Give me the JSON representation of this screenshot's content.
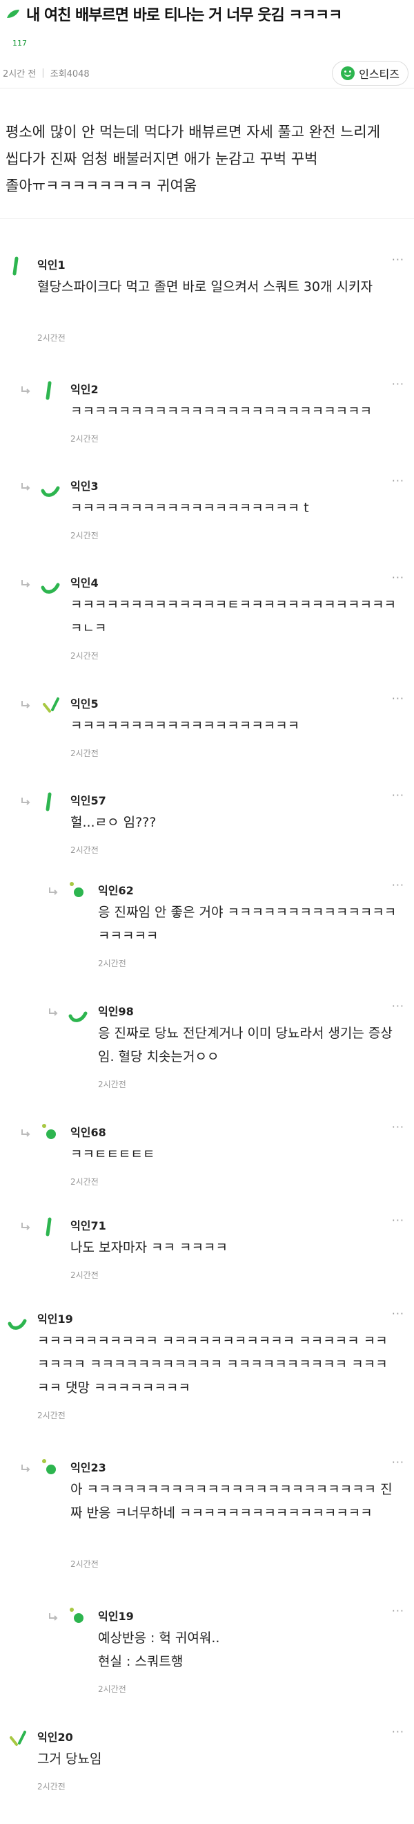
{
  "post": {
    "title": "내 여친 배부르면 바로 티나는 거 너무 웃김 ㅋㅋㅋㅋ",
    "comments_count": "117",
    "time": "2시간 전",
    "views": "조회4048",
    "insti_label": "인스티즈",
    "body": "평소에 많이 안 먹는데 먹다가 배뷰르면 자세 풀고 완전 느리게 씹다가 진짜 엄청 배불러지면 애가 눈감고 꾸벅 꾸벅 졸아ㅠㅋㅋㅋㅋㅋㅋㅋㅋ 귀여움"
  },
  "colors": {
    "accent": "#2db54f",
    "meta": "#888888"
  },
  "comments": [
    {
      "author": "익인1",
      "text": "혈당스파이크다 먹고 졸면 바로 일으켜서 스쿼트 30개 시키자",
      "time": "2시간전",
      "more": "···",
      "reply": false,
      "icon": "green-stroke-icon"
    },
    {
      "author": "익인2",
      "text": "ㅋㅋㅋㅋㅋㅋㅋㅋㅋㅋㅋㅋㅋㅋㅋㅋㅋㅋㅋㅋㅋㅋㅋㅋㅋ",
      "time": "2시간전",
      "more": "···",
      "reply": true,
      "icon": "green-stroke-icon"
    },
    {
      "author": "익인3",
      "text": "ㅋㅋㅋㅋㅋㅋㅋㅋㅋㅋㅋㅋㅋㅋㅋㅋㅋㅋㅋ t",
      "time": "2시간전",
      "more": "···",
      "reply": true,
      "icon": "green-curve-icon"
    },
    {
      "author": "익인4",
      "text": "ㅋㅋㅋㅋㅋㅋㅋㅋㅋㅋㅋㅋㅋㅌㅋㅋㅋㅋㅋㅋㅋㅋㅋㅋㅋㅋㅋㅋㄴㅋ",
      "time": "2시간전",
      "more": "···",
      "reply": true,
      "icon": "green-curve-icon"
    },
    {
      "author": "익인5",
      "text": "ㅋㅋㅋㅋㅋㅋㅋㅋㅋㅋㅋㅋㅋㅋㅋㅋㅋㅋㅋ",
      "time": "2시간전",
      "more": "···",
      "reply": true,
      "icon": "check-leaf-icon"
    },
    {
      "author": "익인57",
      "text": "헐...ㄹㅇ 임???",
      "time": "2시간전",
      "more": "···",
      "reply": true,
      "icon": "green-stroke-icon"
    },
    {
      "author": "익인62",
      "text": "응 진짜임 안 좋은 거야 ㅋㅋㅋㅋㅋㅋㅋㅋㅋㅋㅋㅋㅋㅋㅋㅋㅋㅋㅋ",
      "time": "2시간전",
      "more": "···",
      "reply": true,
      "icon": "green-dots-icon"
    },
    {
      "author": "익인98",
      "text": "응 진짜로 당뇨 전단계거나 이미 당뇨라서 생기는 증상임. 혈당 치솟는거ㅇㅇ",
      "time": "2시간전",
      "more": "···",
      "reply": true,
      "icon": "green-curve-icon"
    },
    {
      "author": "익인68",
      "text": "ㅋㅋㅌㅌㅌㅌㅌ",
      "time": "2시간전",
      "more": "···",
      "reply": true,
      "icon": "green-dots-icon"
    },
    {
      "author": "익인71",
      "text": "나도 보자마자 ㅋㅋ ㅋㅋㅋㅋ",
      "time": "2시간전",
      "more": "···",
      "reply": true,
      "icon": "green-stroke-icon"
    },
    {
      "author": "익인19",
      "text": "ㅋㅋㅋㅋㅋㅋㅋㅋㅋㅋ ㅋㅋㅋㅋㅋㅋㅋㅋㅋㅋㅋ ㅋㅋㅋㅋㅋ ㅋㅋㅋㅋㅋㅋ ㅋㅋㅋㅋㅋㅋㅋㅋㅋㅋㅋ ㅋㅋㅋㅋㅋㅋㅋㅋㅋㅋ ㅋㅋㅋㅋㅋ 댓망 ㅋㅋㅋㅋㅋㅋㅋㅋ",
      "time": "2시간전",
      "more": "···",
      "reply": false,
      "icon": "green-curve-icon"
    },
    {
      "author": "익인23",
      "text": "아 ㅋㅋㅋㅋㅋㅋㅋㅋㅋㅋㅋㅋㅋㅋㅋㅋㅋㅋㅋㅋㅋㅋㅋㅋ 진짜 반응 ㅋ너무하네 ㅋㅋㅋㅋㅋㅋㅋㅋㅋㅋㅋㅋㅋㅋㅋㅋ",
      "time": "2시간전",
      "more": "···",
      "reply": true,
      "icon": "green-dots-icon"
    },
    {
      "author": "익인19",
      "text": "예상반응 : 헉 귀여워..\n현실 : 스쿼트행",
      "time": "2시간전",
      "more": "···",
      "reply": true,
      "icon": "green-dots-icon"
    },
    {
      "author": "익인20",
      "text": "그거 당뇨임",
      "time": "2시간전",
      "more": "···",
      "reply": false,
      "icon": "check-leaf-icon"
    }
  ]
}
